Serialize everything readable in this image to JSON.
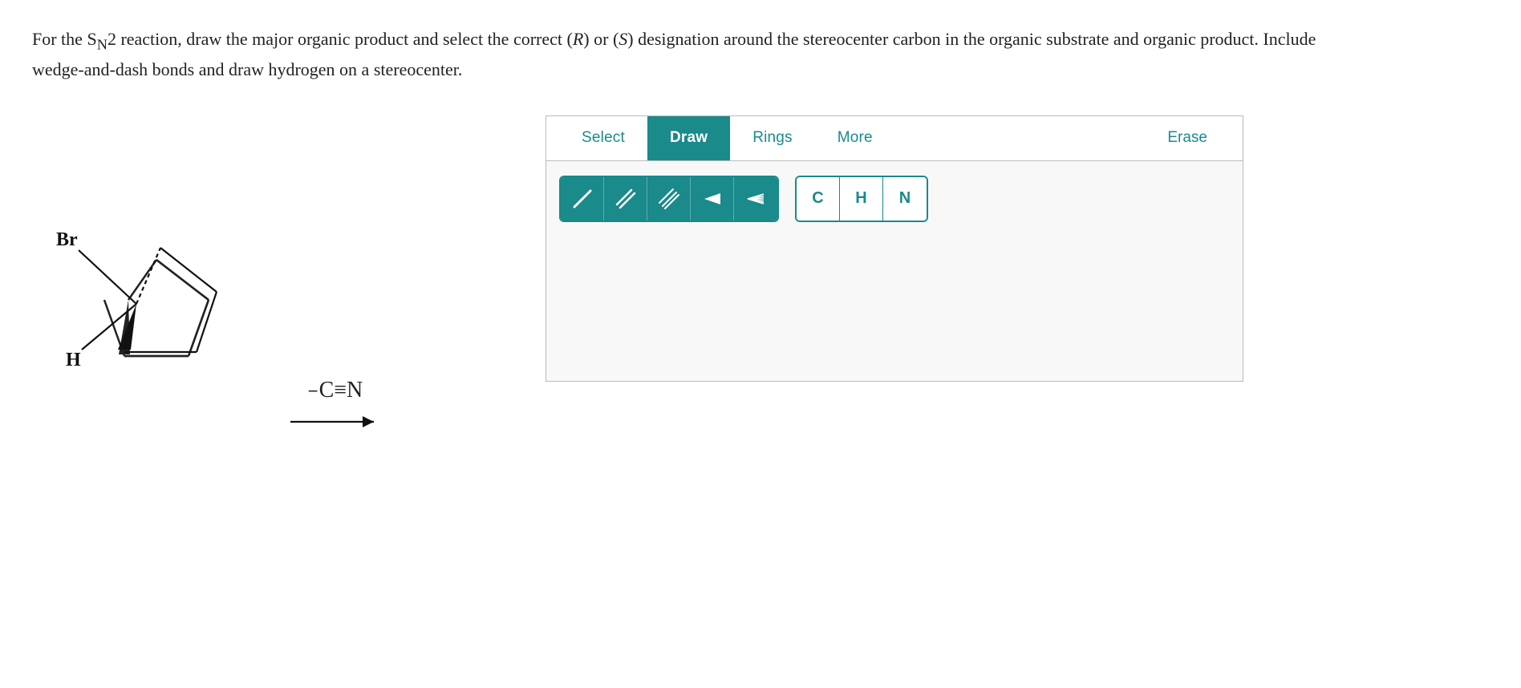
{
  "question": {
    "text_part1": "For the S",
    "subscript_N": "N",
    "text_part2": "2 reaction, draw the major organic product and select the correct (",
    "italic_R": "R",
    "text_part3": ") or (",
    "italic_S": "S",
    "text_part4": ") designation around the stereocenter carbon in the organic substrate and organic product. Include wedge-and-dash bonds and draw hydrogen on a stereocenter."
  },
  "toolbar": {
    "tabs": [
      {
        "id": "select",
        "label": "Select",
        "active": false
      },
      {
        "id": "draw",
        "label": "Draw",
        "active": true
      },
      {
        "id": "rings",
        "label": "Rings",
        "active": false
      },
      {
        "id": "more",
        "label": "More",
        "active": false
      }
    ],
    "erase_label": "Erase",
    "bonds": [
      {
        "id": "single",
        "title": "Single bond"
      },
      {
        "id": "double",
        "title": "Double bond"
      },
      {
        "id": "triple",
        "title": "Triple bond"
      },
      {
        "id": "wedge",
        "title": "Wedge bond"
      },
      {
        "id": "dash",
        "title": "Dash bond"
      }
    ],
    "atoms": [
      {
        "id": "carbon",
        "label": "C"
      },
      {
        "id": "hydrogen",
        "label": "H"
      },
      {
        "id": "nitrogen",
        "label": "N"
      }
    ]
  },
  "reaction": {
    "substrate_labels": {
      "br": "Br",
      "h": "H"
    },
    "reagent": {
      "superscript": "−",
      "formula": "C≡N"
    }
  }
}
